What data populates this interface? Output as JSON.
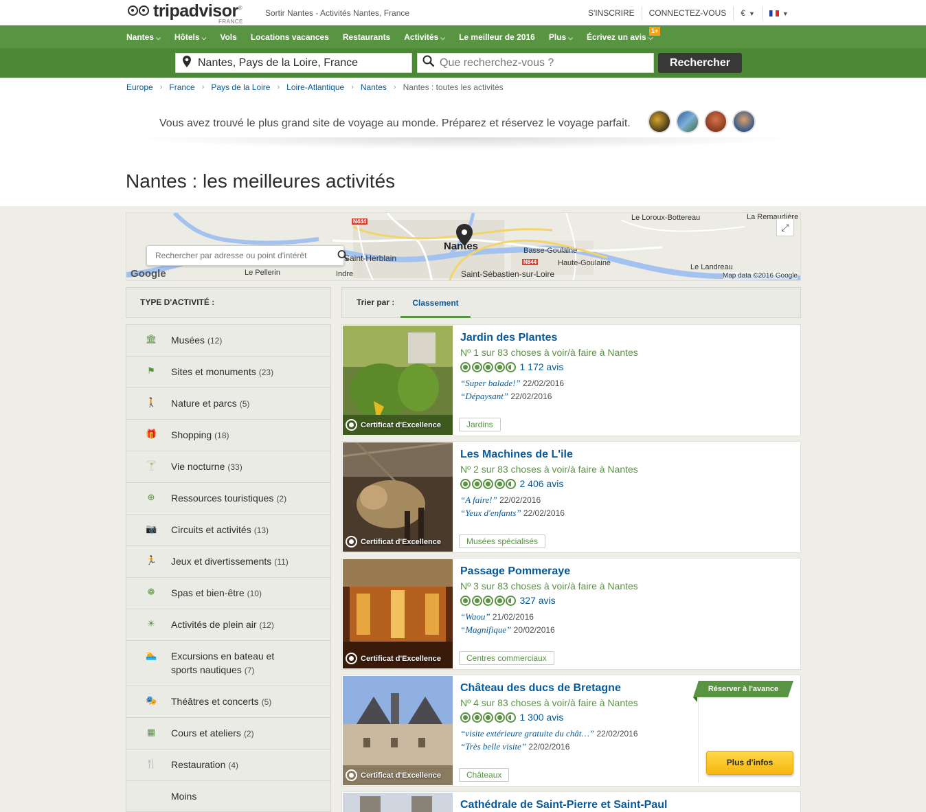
{
  "header": {
    "logo_text": "tripadvisor",
    "logo_sub": "FRANCE",
    "location_link": "Sortir Nantes - Activités Nantes, France",
    "signup": "S'INSCRIRE",
    "login": "CONNECTEZ-VOUS",
    "currency": "€"
  },
  "nav": {
    "items": [
      "Nantes",
      "Hôtels",
      "Vols",
      "Locations vacances",
      "Restaurants",
      "Activités",
      "Le meilleur de 2016",
      "Plus",
      "Écrivez un avis"
    ],
    "new_badge": "1+"
  },
  "search": {
    "where_value": "Nantes, Pays de la Loire, France",
    "what_placeholder": "Que recherchez-vous ?",
    "button": "Rechercher"
  },
  "breadcrumbs": [
    "Europe",
    "France",
    "Pays de la Loire",
    "Loire-Atlantique",
    "Nantes",
    "Nantes : toutes les activités"
  ],
  "tagline": "Vous avez trouvé le plus grand site de voyage au monde. Préparez et réservez le voyage parfait.",
  "page_title": "Nantes : les meilleures activités",
  "map": {
    "search_placeholder": "Rechercher par adresse ou point d'intérêt",
    "labels": [
      "Nantes",
      "Saint-Herblain",
      "Le Pellerin",
      "Indre",
      "Saint-Sébastien-sur-Loire",
      "Basse-Goulaine",
      "Haute-Goulaine",
      "Le Loroux-Bottereau",
      "La Remaudière",
      "Le Landreau"
    ],
    "roads": [
      "N444",
      "N844"
    ],
    "google": "Google",
    "credit": "Map data ©2016 Google"
  },
  "sidebar": {
    "heading": "TYPE D'ACTIVITÉ :",
    "items": [
      {
        "label": "Musées",
        "count": "(12)",
        "icon": "museum-icon"
      },
      {
        "label": "Sites et monuments",
        "count": "(23)",
        "icon": "flag-icon"
      },
      {
        "label": "Nature et parcs",
        "count": "(5)",
        "icon": "hiker-icon"
      },
      {
        "label": "Shopping",
        "count": "(18)",
        "icon": "gift-icon"
      },
      {
        "label": "Vie nocturne",
        "count": "(33)",
        "icon": "cocktail-icon"
      },
      {
        "label": "Ressources touristiques",
        "count": "(2)",
        "icon": "plus-circle-icon"
      },
      {
        "label": "Circuits et activités",
        "count": "(13)",
        "icon": "camera-icon"
      },
      {
        "label": "Jeux et divertissements",
        "count": "(11)",
        "icon": "running-icon"
      },
      {
        "label": "Spas et bien-être",
        "count": "(10)",
        "icon": "spa-icon"
      },
      {
        "label": "Activités de plein air",
        "count": "(12)",
        "icon": "sun-icon"
      },
      {
        "label": "Excursions en bateau et sports nautiques",
        "label_line1": "Excursions en bateau et",
        "label_line2": "sports nautiques",
        "count": "(7)",
        "icon": "swimmer-icon"
      },
      {
        "label": "Théâtres et concerts",
        "count": "(5)",
        "icon": "theater-mask-icon"
      },
      {
        "label": "Cours et ateliers",
        "count": "(2)",
        "icon": "notebook-icon"
      },
      {
        "label": "Restauration",
        "count": "(4)",
        "icon": "food-icon"
      }
    ],
    "less": "Moins"
  },
  "sort": {
    "label": "Trier par :",
    "active_tab": "Classement"
  },
  "listings": [
    {
      "title": "Jardin des Plantes",
      "rank": "Nº 1 sur 83 choses à voir/à faire à Nantes",
      "rating": 4.5,
      "reviews": "1 172 avis",
      "quotes": [
        {
          "text": "“Super balade!”",
          "date": "22/02/2016"
        },
        {
          "text": "“Dépaysant”",
          "date": "22/02/2016"
        }
      ],
      "tag": "Jardins",
      "cert": "Certificat d'Excellence"
    },
    {
      "title": "Les Machines de L'ile",
      "rank": "Nº 2 sur 83 choses à voir/à faire à Nantes",
      "rating": 4.5,
      "reviews": "2 406 avis",
      "quotes": [
        {
          "text": "“A faire!”",
          "date": "22/02/2016"
        },
        {
          "text": "“Yeux d'enfants”",
          "date": "22/02/2016"
        }
      ],
      "tag": "Musées spécialisés",
      "cert": "Certificat d'Excellence"
    },
    {
      "title": "Passage Pommeraye",
      "rank": "Nº 3 sur 83 choses à voir/à faire à Nantes",
      "rating": 4.5,
      "reviews": "327 avis",
      "quotes": [
        {
          "text": "“Waou”",
          "date": "21/02/2016"
        },
        {
          "text": "“Magnifique”",
          "date": "20/02/2016"
        }
      ],
      "tag": "Centres commerciaux",
      "cert": "Certificat d'Excellence"
    },
    {
      "title": "Château des ducs de Bretagne",
      "rank": "Nº 4 sur 83 choses à voir/à faire à Nantes",
      "rating": 4.5,
      "reviews": "1 300 avis",
      "quotes": [
        {
          "text": "“visite extérieure gratuite du chât…”",
          "date": "22/02/2016"
        },
        {
          "text": "“Très belle visite”",
          "date": "22/02/2016"
        }
      ],
      "tag": "Châteaux",
      "cert": "Certificat d'Excellence",
      "ribbon": "Réserver à l'avance",
      "info_button": "Plus d'infos"
    },
    {
      "title": "Cathédrale de Saint-Pierre et Saint-Paul"
    }
  ],
  "colors": {
    "brand_green": "#589442",
    "link_blue": "#06599a",
    "button_yellow": "#f6b60f"
  }
}
